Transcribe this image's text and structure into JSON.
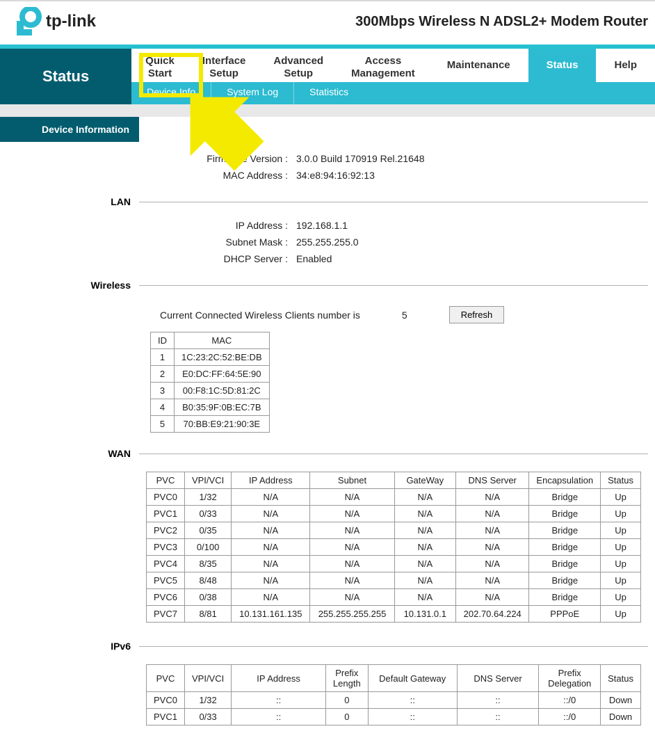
{
  "brand": "tp-link",
  "productTitle": "300Mbps Wireless N ADSL2+ Modem Router",
  "leftTitle": "Status",
  "mainTabs": [
    {
      "l1": "Quick",
      "l2": "Start",
      "twoLine": true
    },
    {
      "l1": "Interface",
      "l2": "Setup",
      "twoLine": true
    },
    {
      "l1": "Advanced",
      "l2": "Setup",
      "twoLine": true
    },
    {
      "l1": "Access",
      "l2": "Management",
      "twoLine": true
    },
    {
      "l1": "Maintenance",
      "twoLine": false
    },
    {
      "l1": "Status",
      "twoLine": false,
      "active": true
    },
    {
      "l1": "Help",
      "twoLine": false
    }
  ],
  "subTabs": [
    "Device Info",
    "System Log",
    "Statistics"
  ],
  "sections": {
    "deviceInfoHeader": "Device Information",
    "firmware": {
      "label": "Firmware Version",
      "value": "3.0.0 Build 170919 Rel.21648"
    },
    "mac": {
      "label": "MAC Address",
      "value": "34:e8:94:16:92:13"
    },
    "lan": {
      "title": "LAN",
      "ip": {
        "label": "IP Address",
        "value": "192.168.1.1"
      },
      "subnet": {
        "label": "Subnet Mask",
        "value": "255.255.255.0"
      },
      "dhcp": {
        "label": "DHCP Server",
        "value": "Enabled"
      }
    },
    "wireless": {
      "title": "Wireless",
      "clientsLabel": "Current Connected Wireless Clients number is",
      "clientsCount": "5",
      "refresh": "Refresh",
      "tableHeaders": [
        "ID",
        "MAC"
      ],
      "clients": [
        {
          "id": "1",
          "mac": "1C:23:2C:52:BE:DB"
        },
        {
          "id": "2",
          "mac": "E0:DC:FF:64:5E:90"
        },
        {
          "id": "3",
          "mac": "00:F8:1C:5D:81:2C"
        },
        {
          "id": "4",
          "mac": "B0:35:9F:0B:EC:7B"
        },
        {
          "id": "5",
          "mac": "70:BB:E9:21:90:3E"
        }
      ]
    },
    "wan": {
      "title": "WAN",
      "headers": [
        "PVC",
        "VPI/VCI",
        "IP Address",
        "Subnet",
        "GateWay",
        "DNS Server",
        "Encapsulation",
        "Status"
      ],
      "rows": [
        [
          "PVC0",
          "1/32",
          "N/A",
          "N/A",
          "N/A",
          "N/A",
          "Bridge",
          "Up"
        ],
        [
          "PVC1",
          "0/33",
          "N/A",
          "N/A",
          "N/A",
          "N/A",
          "Bridge",
          "Up"
        ],
        [
          "PVC2",
          "0/35",
          "N/A",
          "N/A",
          "N/A",
          "N/A",
          "Bridge",
          "Up"
        ],
        [
          "PVC3",
          "0/100",
          "N/A",
          "N/A",
          "N/A",
          "N/A",
          "Bridge",
          "Up"
        ],
        [
          "PVC4",
          "8/35",
          "N/A",
          "N/A",
          "N/A",
          "N/A",
          "Bridge",
          "Up"
        ],
        [
          "PVC5",
          "8/48",
          "N/A",
          "N/A",
          "N/A",
          "N/A",
          "Bridge",
          "Up"
        ],
        [
          "PVC6",
          "0/38",
          "N/A",
          "N/A",
          "N/A",
          "N/A",
          "Bridge",
          "Up"
        ],
        [
          "PVC7",
          "8/81",
          "10.131.161.135",
          "255.255.255.255",
          "10.131.0.1",
          "202.70.64.224",
          "PPPoE",
          "Up"
        ]
      ]
    },
    "ipv6": {
      "title": "IPv6",
      "headers": [
        "PVC",
        "VPI/VCI",
        "IP Address",
        "Prefix Length",
        "Default Gateway",
        "DNS Server",
        "Prefix Delegation",
        "Status"
      ],
      "rows": [
        [
          "PVC0",
          "1/32",
          "::",
          "0",
          "::",
          "::",
          "::/0",
          "Down"
        ],
        [
          "PVC1",
          "0/33",
          "::",
          "0",
          "::",
          "::",
          "::/0",
          "Down"
        ]
      ]
    }
  }
}
